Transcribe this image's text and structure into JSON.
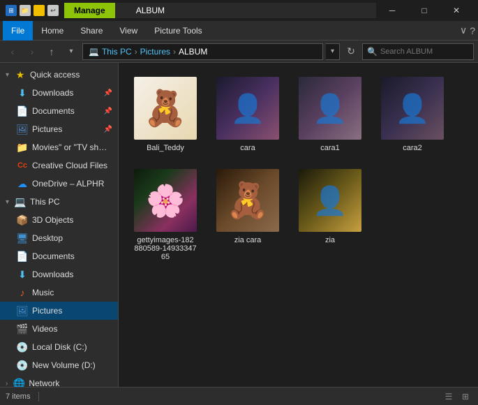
{
  "titlebar": {
    "manage_label": "Manage",
    "album_label": "ALBUM",
    "minimize": "─",
    "maximize": "□",
    "close": "✕"
  },
  "menubar": {
    "file": "File",
    "home": "Home",
    "share": "Share",
    "view": "View",
    "picture_tools": "Picture Tools"
  },
  "navbar": {
    "breadcrumb": {
      "this_pc": "This PC",
      "pictures": "Pictures",
      "album": "ALBUM"
    },
    "search_placeholder": "Search ALBUM"
  },
  "sidebar": {
    "items": [
      {
        "id": "downloads-quick",
        "label": "Downloads",
        "icon": "⬇",
        "icon_class": "icon-download",
        "indented": 1,
        "pinned": true
      },
      {
        "id": "documents-quick",
        "label": "Documents",
        "icon": "📄",
        "icon_class": "icon-docs",
        "indented": 1,
        "pinned": true
      },
      {
        "id": "pictures-quick",
        "label": "Pictures",
        "icon": "🖼",
        "icon_class": "icon-pics",
        "indented": 1,
        "pinned": true
      },
      {
        "id": "movies-quick",
        "label": "Movies\" or \"TV sh…",
        "icon": "📁",
        "icon_class": "icon-movies",
        "indented": 1,
        "pinned": false
      },
      {
        "id": "creative-cloud",
        "label": "Creative Cloud Files",
        "icon": "☁",
        "icon_class": "icon-cc",
        "indented": 1,
        "pinned": false
      },
      {
        "id": "onedrive",
        "label": "OneDrive – ALPHR",
        "icon": "☁",
        "icon_class": "icon-onedrive",
        "indented": 1,
        "pinned": false
      },
      {
        "id": "this-pc",
        "label": "This PC",
        "icon": "💻",
        "icon_class": "icon-pc",
        "indented": 0,
        "pinned": false,
        "expanded": true
      },
      {
        "id": "3d-objects",
        "label": "3D Objects",
        "icon": "📦",
        "icon_class": "icon-3d",
        "indented": 2,
        "pinned": false
      },
      {
        "id": "desktop",
        "label": "Desktop",
        "icon": "🖥",
        "icon_class": "icon-desktop",
        "indented": 2,
        "pinned": false
      },
      {
        "id": "documents-pc",
        "label": "Documents",
        "icon": "📄",
        "icon_class": "icon-docs",
        "indented": 2,
        "pinned": false
      },
      {
        "id": "downloads-pc",
        "label": "Downloads",
        "icon": "⬇",
        "icon_class": "icon-download",
        "indented": 2,
        "pinned": false
      },
      {
        "id": "music",
        "label": "Music",
        "icon": "♪",
        "icon_class": "icon-music",
        "indented": 2,
        "pinned": false
      },
      {
        "id": "pictures-pc",
        "label": "Pictures",
        "icon": "🖼",
        "icon_class": "icon-pics",
        "indented": 2,
        "active": true,
        "pinned": false
      },
      {
        "id": "videos",
        "label": "Videos",
        "icon": "🎬",
        "icon_class": "icon-video",
        "indented": 2,
        "pinned": false
      },
      {
        "id": "local-disk-c",
        "label": "Local Disk (C:)",
        "icon": "💿",
        "icon_class": "icon-disk",
        "indented": 2,
        "pinned": false
      },
      {
        "id": "new-volume-d",
        "label": "New Volume (D:)",
        "icon": "💿",
        "icon_class": "icon-disk",
        "indented": 2,
        "pinned": false
      },
      {
        "id": "network",
        "label": "Network",
        "icon": "🌐",
        "icon_class": "icon-network",
        "indented": 0,
        "pinned": false
      }
    ]
  },
  "files": [
    {
      "id": "bali-teddy",
      "name": "Bali_Teddy",
      "thumb_class": "thumb-teddy",
      "icon": "🧸"
    },
    {
      "id": "cara",
      "name": "cara",
      "thumb_class": "thumb-cara",
      "icon": "👤"
    },
    {
      "id": "cara1",
      "name": "cara1",
      "thumb_class": "thumb-cara1",
      "icon": "👤"
    },
    {
      "id": "cara2",
      "name": "cara2",
      "thumb_class": "thumb-cara2",
      "icon": "👤"
    },
    {
      "id": "gettyimages",
      "name": "gettyimages-182\n880589-14933347\n65",
      "thumb_class": "thumb-getty",
      "icon": "🌸"
    },
    {
      "id": "zia-cara",
      "name": "zia cara",
      "thumb_class": "thumb-ziacara",
      "icon": "🧸"
    },
    {
      "id": "zia",
      "name": "zia",
      "thumb_class": "thumb-zia",
      "icon": "👤"
    }
  ],
  "statusbar": {
    "count": "7 items",
    "separator": "|"
  }
}
